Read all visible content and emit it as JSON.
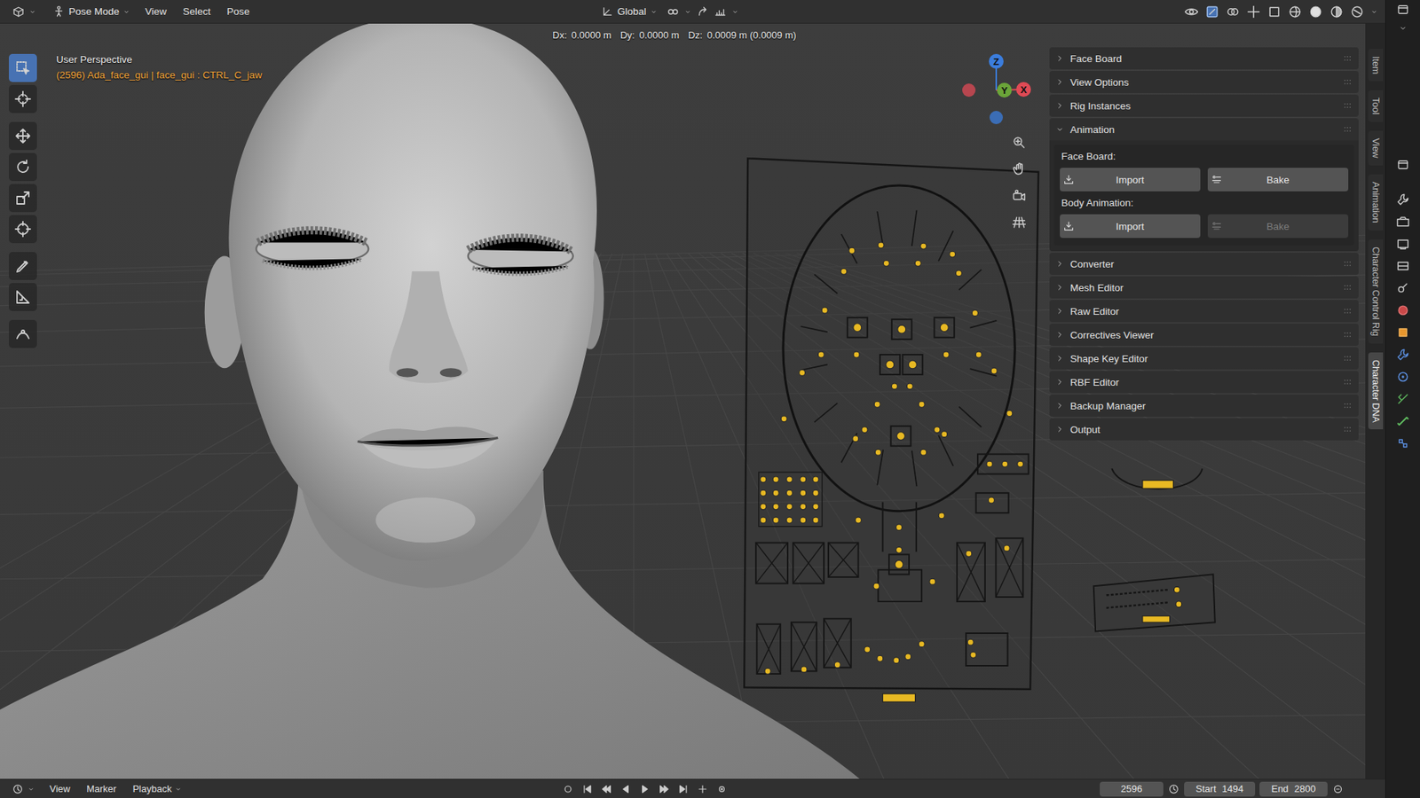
{
  "header": {
    "mode": "Pose Mode",
    "menus": [
      "View",
      "Select",
      "Pose"
    ],
    "orientation": "Global"
  },
  "transform_info": [
    {
      "label": "Dx:",
      "value": "0.0000 m"
    },
    {
      "label": "Dy:",
      "value": "0.0000 m"
    },
    {
      "label": "Dz:",
      "value": "0.0009 m (0.0009 m)"
    }
  ],
  "toolbar": [
    {
      "kind": "select",
      "selected": true
    },
    {
      "kind": "cursor",
      "selected": false
    },
    {
      "kind": "move",
      "selected": false
    },
    {
      "kind": "rotate",
      "selected": false
    },
    {
      "kind": "scale",
      "selected": false
    },
    {
      "kind": "transform",
      "selected": false
    },
    {
      "kind": "annotate",
      "selected": false
    },
    {
      "kind": "measure",
      "selected": false
    },
    {
      "kind": "roll",
      "selected": false
    }
  ],
  "viewport": {
    "view": "User Perspective",
    "active": "(2596) Ada_face_gui | face_gui : CTRL_C_jaw"
  },
  "gizmo": [
    {
      "label": "Z",
      "color": "#3b7ddd"
    },
    {
      "label": "Y",
      "color": "#6ba539"
    },
    {
      "label": "X",
      "color": "#e04a55"
    }
  ],
  "sidebar": {
    "sections": [
      {
        "title": "Face Board",
        "expanded": false
      },
      {
        "title": "View Options",
        "expanded": false
      },
      {
        "title": "Rig Instances",
        "expanded": false
      },
      {
        "title": "Animation",
        "expanded": true,
        "groups": [
          {
            "label": "Face Board:",
            "buttons": [
              {
                "label": "Import",
                "kind": "import",
                "disabled": false
              },
              {
                "label": "Bake",
                "kind": "bake",
                "disabled": false
              }
            ]
          },
          {
            "label": "Body Animation:",
            "buttons": [
              {
                "label": "Import",
                "kind": "import",
                "disabled": false
              },
              {
                "label": "Bake",
                "kind": "bake",
                "disabled": true
              }
            ]
          }
        ]
      },
      {
        "title": "Converter",
        "expanded": false
      },
      {
        "title": "Mesh Editor",
        "expanded": false
      },
      {
        "title": "Raw Editor",
        "expanded": false
      },
      {
        "title": "Correctives Viewer",
        "expanded": false
      },
      {
        "title": "Shape Key Editor",
        "expanded": false
      },
      {
        "title": "RBF Editor",
        "expanded": false
      },
      {
        "title": "Backup Manager",
        "expanded": false
      },
      {
        "title": "Output",
        "expanded": false
      }
    ]
  },
  "sidebar_tabs": [
    {
      "label": "Item",
      "selected": false
    },
    {
      "label": "Tool",
      "selected": false
    },
    {
      "label": "View",
      "selected": false
    },
    {
      "label": "Animation",
      "selected": false
    },
    {
      "label": "Character Control Rig",
      "selected": false
    },
    {
      "label": "Character DNA",
      "selected": true
    }
  ],
  "timeline": {
    "menus": [
      "View",
      "Marker",
      "Playback"
    ],
    "frame": "2596",
    "start_label": "Start",
    "start": "1494",
    "end_label": "End",
    "end": "2800"
  }
}
